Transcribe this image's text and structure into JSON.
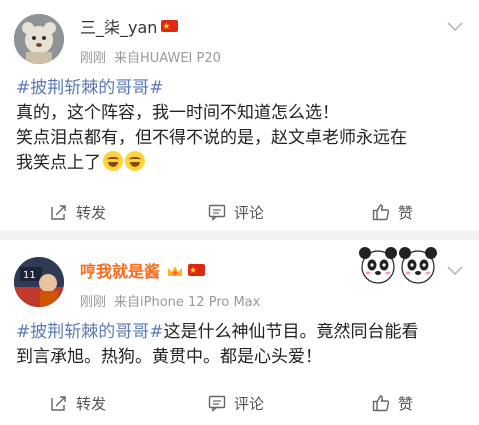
{
  "posts": [
    {
      "username": "三_柒_yan",
      "time": "刚刚",
      "source": "来自HUAWEI P20",
      "hashtag": "#披荆斩棘的哥哥#",
      "line1": "真的，这个阵容，我一时间不知道怎么选！",
      "line2": "笑点泪点都有，但不得不说的是，赵文卓老师永远在",
      "line3": "我笑点上了",
      "actions": {
        "repost": "转发",
        "comment": "评论",
        "like": "赞"
      }
    },
    {
      "username": "哼我就是酱",
      "time": "刚刚",
      "source": "来自iPhone 12 Pro Max",
      "hashtag": "#披荆斩棘的哥哥#",
      "text_after_tag": "这是什么神仙节目。竟然同台能看",
      "line2": "到言承旭。热狗。黄贯中。都是心头爱！",
      "actions": {
        "repost": "转发",
        "comment": "评论",
        "like": "赞"
      }
    }
  ],
  "colors": {
    "hashtag": "#5b7ab8",
    "username_vip": "#f86a1c",
    "meta": "#999999",
    "separator": "#f2f2f2"
  },
  "icons": [
    "flag-icon",
    "chevron-down-icon",
    "repost-icon",
    "comment-icon",
    "like-icon",
    "laugh-cry-emoji-icon",
    "crown-badge-icon",
    "panda-sticker-icon"
  ]
}
